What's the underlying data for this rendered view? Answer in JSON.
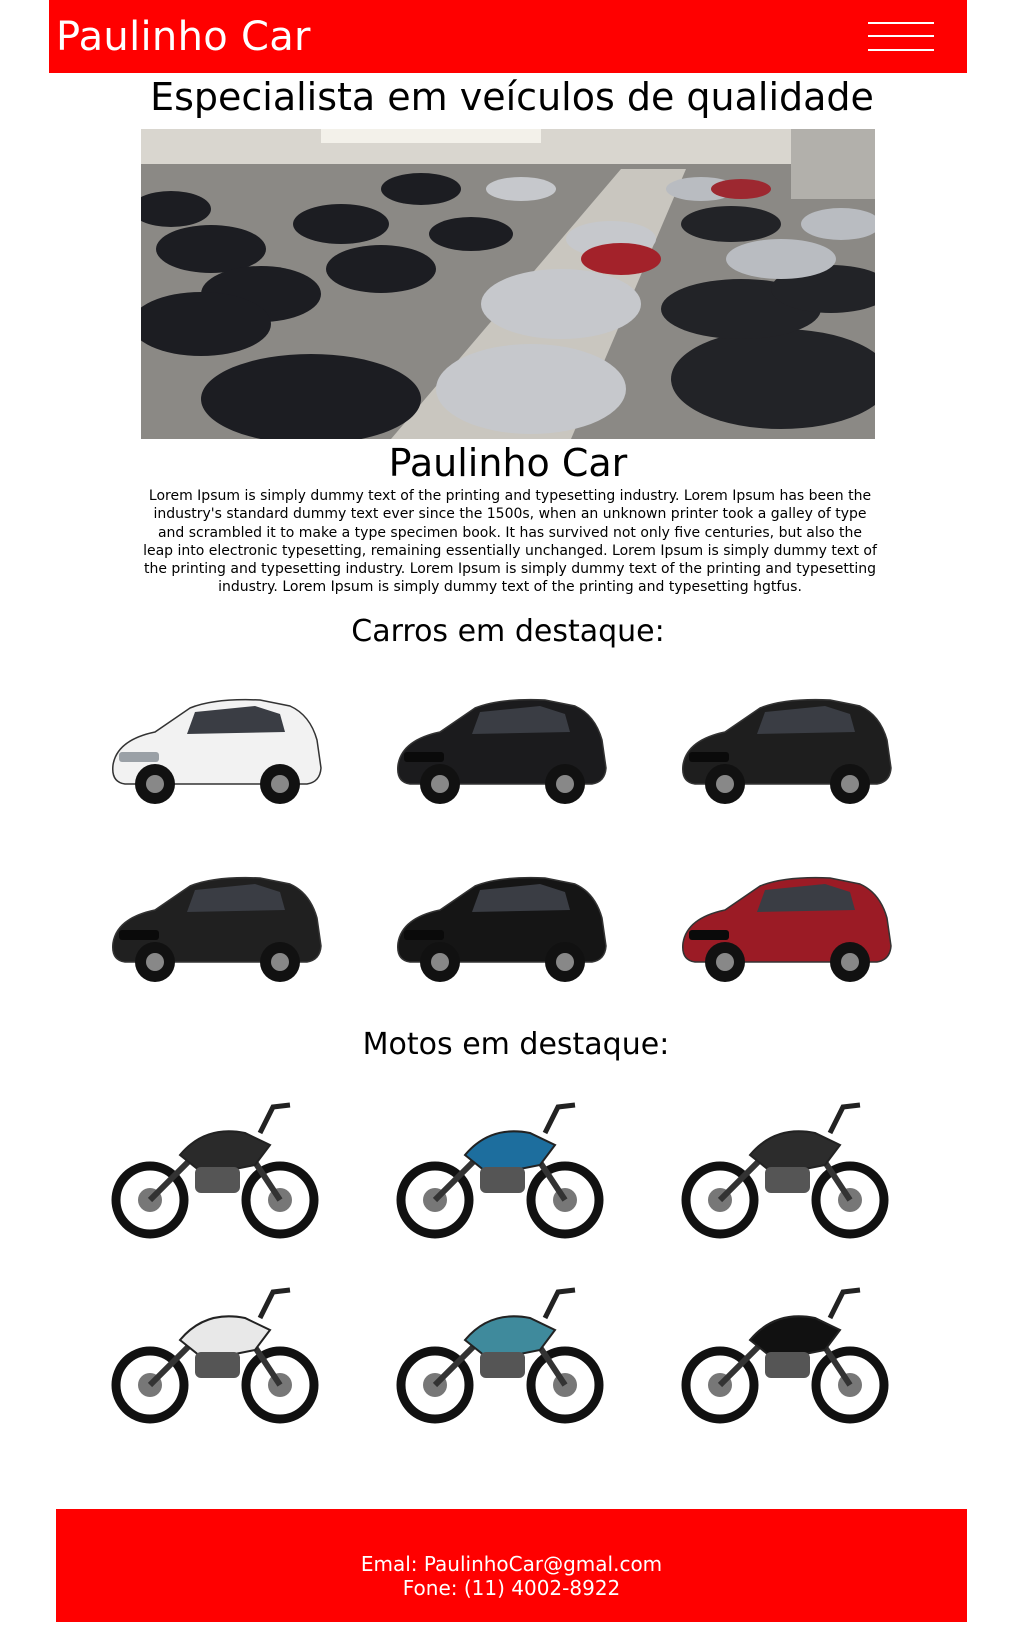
{
  "header": {
    "brand": "Paulinho Car",
    "menu_icon": "hamburger-menu-icon",
    "background_color": "#ff0000"
  },
  "hero": {
    "headline": "Especialista em veículos de qualidade",
    "image": "car-dealership-showroom-photo"
  },
  "about": {
    "title": "Paulinho Car",
    "text": "Lorem Ipsum is simply dummy text of the printing and typesetting industry. Lorem Ipsum has been the industry's standard dummy text ever since the 1500s, when an unknown printer took a galley of type and scrambled it to make a type specimen book. It has survived not only five centuries, but also the leap into electronic typesetting, remaining essentially unchanged. Lorem Ipsum is simply dummy text of the printing and typesetting industry. Lorem Ipsum is simply dummy text of the printing and typesetting industry. Lorem Ipsum is simply dummy text of the printing and typesetting hgtfus."
  },
  "cars": {
    "title": "Carros em destaque:",
    "items": [
      {
        "image": "white-sedan-image",
        "color": "#f2f2f2"
      },
      {
        "image": "black-sedan-image",
        "color": "#1b1b1d"
      },
      {
        "image": "black-suv-image",
        "color": "#1e1e1e"
      },
      {
        "image": "black-pickup-truck-image",
        "color": "#202020"
      },
      {
        "image": "black-luxury-suv-image",
        "color": "#151515"
      },
      {
        "image": "red-suv-image",
        "color": "#9b1b25"
      }
    ]
  },
  "motos": {
    "title": "Motos em destaque:",
    "items": [
      {
        "image": "black-naked-motorcycle-image",
        "color": "#2a2a2a"
      },
      {
        "image": "blue-naked-motorcycle-image",
        "color": "#1d6e9e"
      },
      {
        "image": "black-sport-motorcycle-image",
        "color": "#2c2c2c"
      },
      {
        "image": "white-naked-motorcycle-image",
        "color": "#e8e8e8"
      },
      {
        "image": "teal-cruiser-motorcycle-image",
        "color": "#3f8a9c"
      },
      {
        "image": "black-sportbike-image",
        "color": "#111111"
      }
    ]
  },
  "footer": {
    "email": "Emal: PaulinhoCar@gmal.com",
    "phone": "Fone: (11) 4002-8922",
    "background_color": "#ff0000"
  }
}
